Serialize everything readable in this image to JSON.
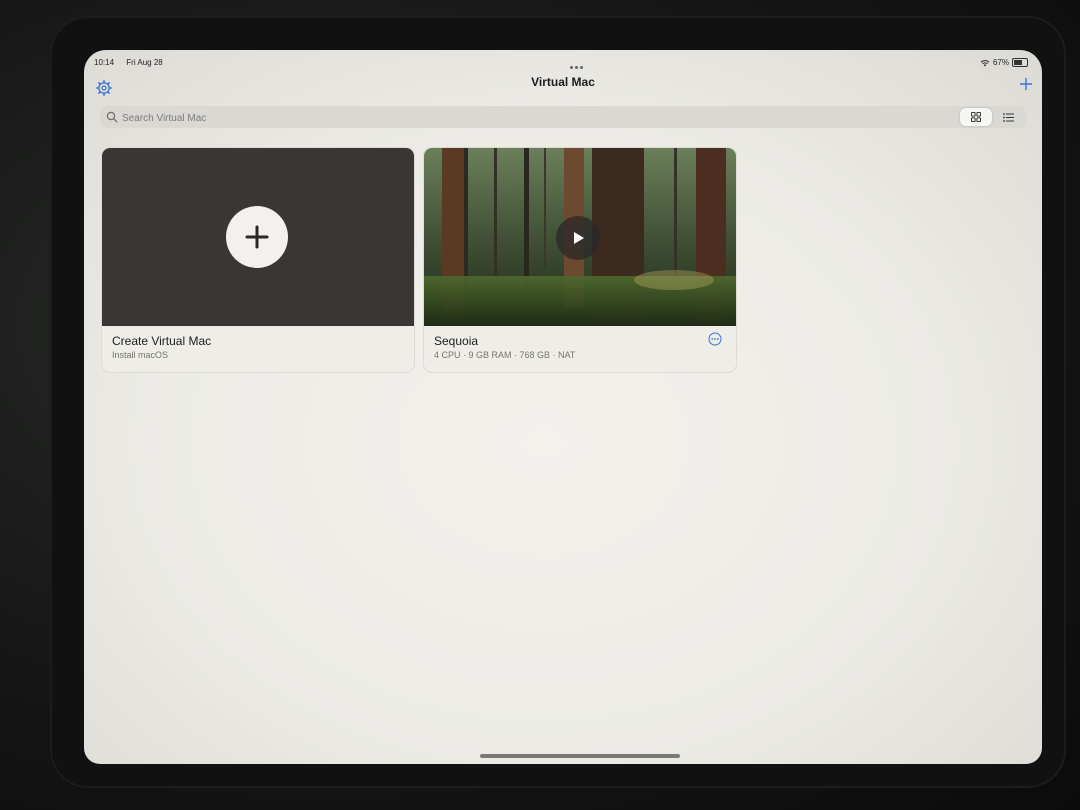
{
  "status": {
    "time": "10:14",
    "date": "Fri Aug 28",
    "battery_text": "67%",
    "battery_level": 0.67
  },
  "navbar": {
    "title": "Virtual Mac"
  },
  "search": {
    "placeholder": "Search Virtual Mac"
  },
  "view_toggle": {
    "options": [
      "grid-icon",
      "list-icon"
    ],
    "selected": "grid-icon"
  },
  "cards": [
    {
      "name": "Create Virtual Mac",
      "subtitle": "Install macOS"
    },
    {
      "name": "Sequoia",
      "subtitle": "4 CPU · 9 GB RAM · 768 GB · NAT"
    }
  ],
  "colors": {
    "accent": "#3b73d6",
    "screen_bg": "#ecebe6",
    "card_bg": "#eeede8"
  }
}
